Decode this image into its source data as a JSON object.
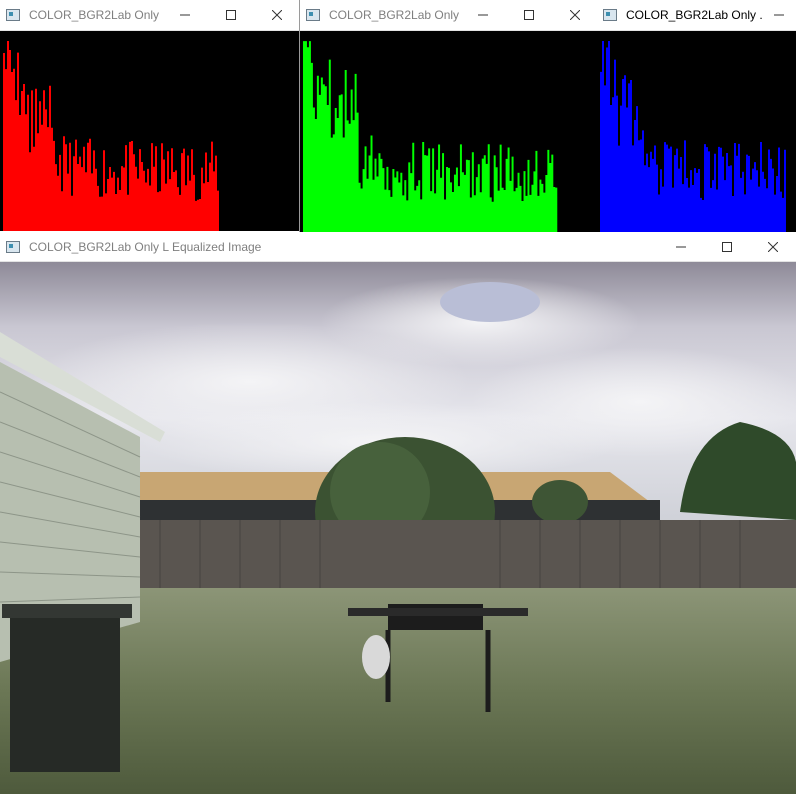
{
  "windows": [
    {
      "title": "COLOR_BGR2Lab Only ...",
      "active": false,
      "color": "#ff0000"
    },
    {
      "title": "COLOR_BGR2Lab Only ...",
      "active": false,
      "color": "#00ff00"
    },
    {
      "title": "COLOR_BGR2Lab Only ...",
      "active": true,
      "color": "#0000ff"
    }
  ],
  "image_window": {
    "title": "COLOR_BGR2Lab Only L Equalized Image",
    "image": "backyard-scene"
  },
  "icons": {
    "minimize": "minimize-icon",
    "maximize": "maximize-icon",
    "close": "close-icon"
  }
}
